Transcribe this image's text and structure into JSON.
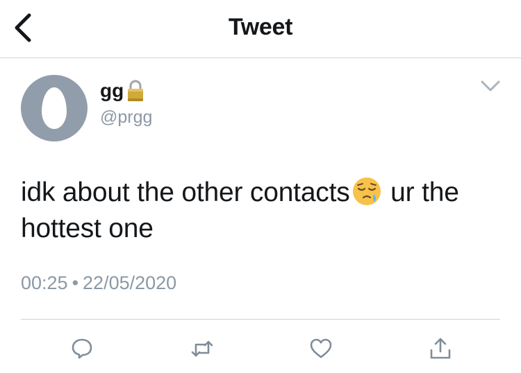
{
  "header": {
    "title": "Tweet"
  },
  "author": {
    "display_name": "gg",
    "handle": "@prgg",
    "protected": true
  },
  "tweet": {
    "text_before_emoji": "idk about the other contacts",
    "emoji": "sleepy-face",
    "text_after_emoji": " ur the hottest one",
    "time": "00:25",
    "separator": "•",
    "date": "22/05/2020"
  },
  "actions": [
    "reply-icon",
    "retweet-icon",
    "like-icon",
    "share-icon"
  ],
  "colors": {
    "text": "#14171a",
    "muted": "#8b98a5",
    "avatar": "#919dab",
    "divider": "#cfd2d6"
  }
}
